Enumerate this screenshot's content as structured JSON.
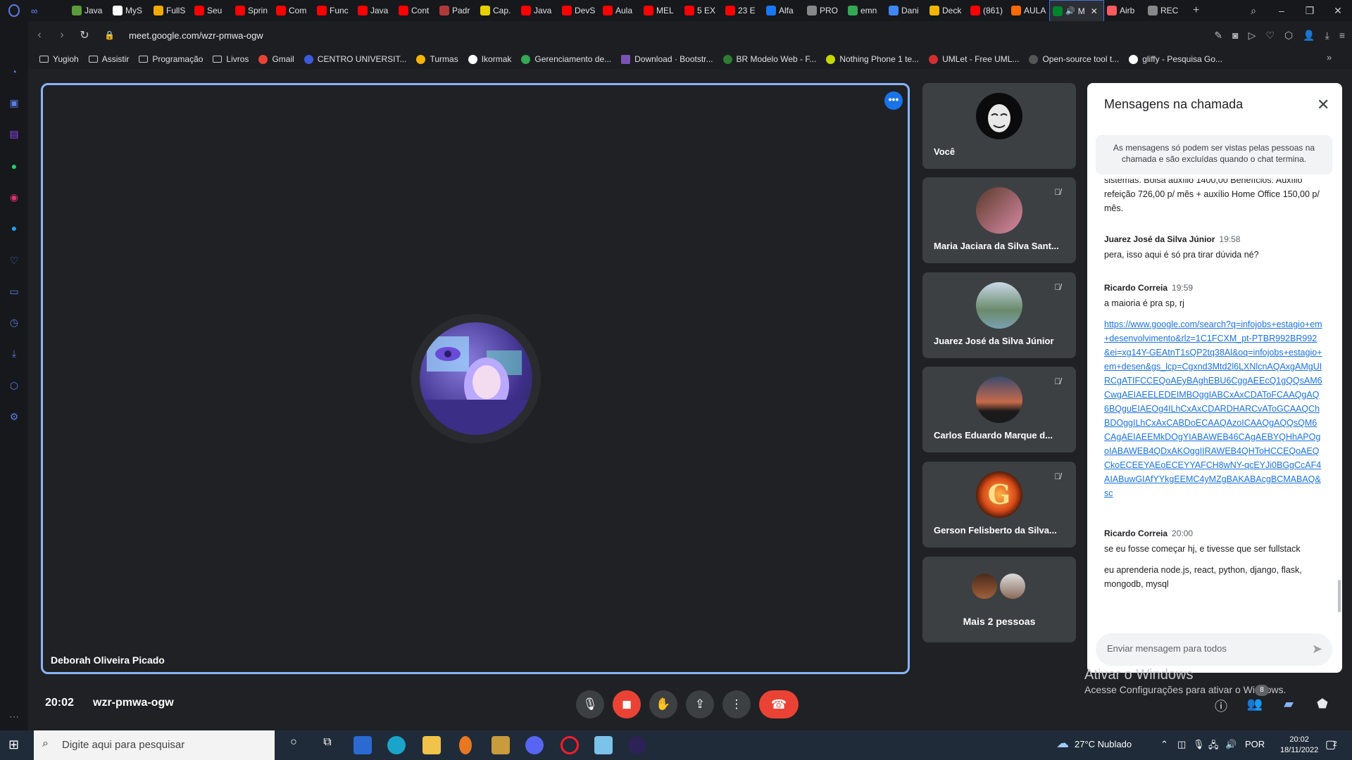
{
  "browser": {
    "tabs": [
      {
        "label": "Java",
        "color": "#5b9b3b"
      },
      {
        "label": "MyS",
        "color": "#ffffff"
      },
      {
        "label": "FullS",
        "color": "#f2a900"
      },
      {
        "label": "Seu",
        "color": "#ff0000"
      },
      {
        "label": "Sprin",
        "color": "#ff0000"
      },
      {
        "label": "Com",
        "color": "#ff0000"
      },
      {
        "label": "Func",
        "color": "#ff0000"
      },
      {
        "label": "Java",
        "color": "#ff0000"
      },
      {
        "label": "Cont",
        "color": "#ff0000"
      },
      {
        "label": "Padr",
        "color": "#b03a3a"
      },
      {
        "label": "Cap.",
        "color": "#e5d000"
      },
      {
        "label": "Java",
        "color": "#ff0000"
      },
      {
        "label": "DevS",
        "color": "#ff0000"
      },
      {
        "label": "Aula",
        "color": "#ff0000"
      },
      {
        "label": "MEL",
        "color": "#ff0000"
      },
      {
        "label": "5 EX",
        "color": "#ff0000"
      },
      {
        "label": "23 E",
        "color": "#ff0000"
      },
      {
        "label": "Alfa",
        "color": "#1877f2"
      },
      {
        "label": "PRO",
        "color": "#888888"
      },
      {
        "label": "emn",
        "color": "#34a853"
      },
      {
        "label": "Dani",
        "color": "#4285f4"
      },
      {
        "label": "Deck",
        "color": "#f2b600"
      },
      {
        "label": "(861)",
        "color": "#ff0000"
      },
      {
        "label": "AULA",
        "color": "#ff6a00"
      }
    ],
    "active_tab": {
      "label": "M",
      "color": "#00832d"
    },
    "tabs_after": [
      {
        "label": "Airb",
        "color": "#ff5a5f"
      },
      {
        "label": "REC",
        "color": "#888888"
      }
    ],
    "url": "meet.google.com/wzr-pmwa-ogw",
    "bookmarks": [
      {
        "label": "Yugioh",
        "icon": "folder-icon"
      },
      {
        "label": "Assistir",
        "icon": "folder-icon"
      },
      {
        "label": "Programação",
        "icon": "folder-icon"
      },
      {
        "label": "Livros",
        "icon": "folder-icon"
      },
      {
        "label": "Gmail",
        "icon": "gmail-icon"
      },
      {
        "label": "CENTRO UNIVERSIT...",
        "icon": "globe-icon"
      },
      {
        "label": "Turmas",
        "icon": "classroom-icon"
      },
      {
        "label": "Ikormak",
        "icon": "github-icon"
      },
      {
        "label": "Gerenciamento de...",
        "icon": "green-icon"
      },
      {
        "label": "Download · Bootstr...",
        "icon": "bootstrap-icon"
      },
      {
        "label": "BR Modelo Web - F...",
        "icon": "br-icon"
      },
      {
        "label": "Nothing Phone 1 te...",
        "icon": "nothing-icon"
      },
      {
        "label": "UMLet - Free UML...",
        "icon": "umlet-icon"
      },
      {
        "label": "Open-source tool t...",
        "icon": "tool-icon"
      },
      {
        "label": "gliffy - Pesquisa Go...",
        "icon": "google-icon"
      }
    ]
  },
  "meet": {
    "main_speaker": "Deborah Oliveira Picado",
    "participants": [
      {
        "name": "Você",
        "muted": false,
        "avatar_color": "#e8e8e8"
      },
      {
        "name": "Maria Jaciara da Silva Sant...",
        "muted": true,
        "avatar_color": "#d98aa6"
      },
      {
        "name": "Juarez José da Silva Júnior",
        "muted": true,
        "avatar_color": "#7aa0b0"
      },
      {
        "name": "Carlos Eduardo Marque d...",
        "muted": true,
        "avatar_color": "#c66a4a"
      },
      {
        "name": "Gerson Felisberto da Silva...",
        "muted": true,
        "avatar_color": "#d84a1a"
      }
    ],
    "more_people": "Mais 2 pessoas",
    "time": "20:02",
    "meeting_code": "wzr-pmwa-ogw",
    "activate_title": "Ativar o Windows",
    "activate_sub": "Acesse Configurações para ativar o Windows.",
    "people_count": "8"
  },
  "chat": {
    "title": "Mensagens na chamada",
    "info": "As mensagens só podem ser vistas pelas pessoas na chamada e são excluídas quando o chat termina.",
    "partial_message": "sistemas. Bolsa auxílio 1400,00 Benefícios: Auxílio refeição 726,00 p/ mês + auxílio Home Office 150,00 p/ mês.",
    "messages": [
      {
        "author": "Juarez José da Silva Júnior",
        "time": "19:58",
        "texts": [
          "pera, isso aqui é só pra tirar dúvida né?"
        ]
      },
      {
        "author": "Ricardo Correia",
        "time": "19:59",
        "texts": [
          "a maioria é pra sp, rj"
        ]
      },
      {
        "author": "Ricardo Correia",
        "time": "20:00",
        "texts": [
          "se eu fosse começar hj, e tivesse que ser fullstack",
          "eu aprenderia node.js, react, python, django, flask, mongodb, mysql"
        ]
      }
    ],
    "link": "https://www.google.com/search?q=infojobs+estagio+em+desenvolvimento&rlz=1C1FCXM_pt-PTBR992BR992&ei=xg14Y-GEAtnT1sQP2tq38Al&oq=infojobs+estagio+em+desen&gs_lcp=Cgxnd3Mtd2l6LXNlcnAQAxgAMgUIRCgATIFCCEQoAEyBAghEBU6CggAEEcQ1gQQsAM6CwgAEIAEELEDEIMBOggIABCxAxCDAToFCAAQgAQ6BQguEIAEOg4ILhCxAxCDARDHARCvAToGCAAQChBDOggILhCxAxCABDoECAAQAzoICAAQgAQQsQM6CAgAEIAEEMkDOgYIABAWEB46CAgAEBYQHhAPOgoIABAWEB4QDxAKOggIIRAWEB4QHToHCCEQoAEQCkoECEEYAEoECEYYAFCH8wNY-qcEYJi0BGgCcAF4AIABuwGIAfYYkgEEMC4yMZgBAKABAcgBCMABAQ&sc",
    "input_placeholder": "Enviar mensagem para todos"
  },
  "taskbar": {
    "search_placeholder": "Digite aqui para pesquisar",
    "weather": "27°C  Nublado",
    "language": "POR",
    "clock_time": "20:02",
    "clock_date": "18/11/2022",
    "notif_count": "2"
  },
  "colors": {
    "accent_blue": "#8ab4f8",
    "meet_red": "#ea4335",
    "meet_bg": "#202124"
  }
}
